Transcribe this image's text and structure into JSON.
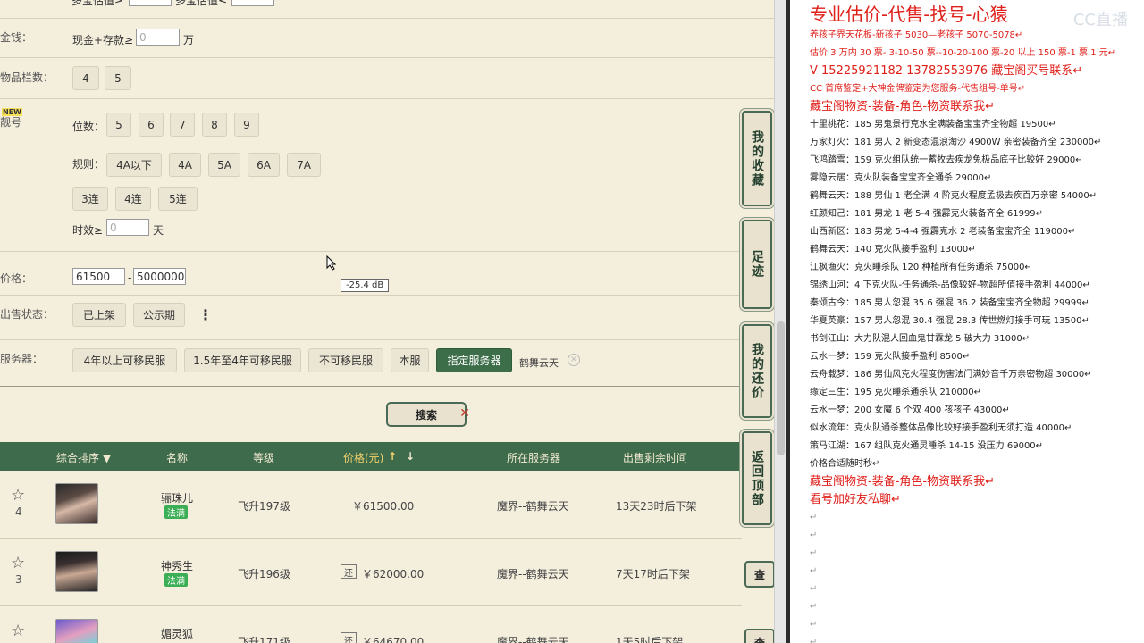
{
  "filters": {
    "top_partial": {
      "label_a": "多宝估值≥",
      "label_b": "多宝估值≤"
    },
    "money": {
      "label": "金钱：",
      "sub": "现金+存款≥",
      "placeholder": "0",
      "unit": "万"
    },
    "inventory": {
      "label": "物品栏数：",
      "options": [
        "4",
        "5"
      ]
    },
    "pretty_id": {
      "label": "靓号",
      "badge": "NEW",
      "digits_label": "位数：",
      "digits": [
        "5",
        "6",
        "7",
        "8",
        "9"
      ],
      "rule_label": "规则：",
      "rules": [
        "4A以下",
        "4A",
        "5A",
        "6A",
        "7A"
      ],
      "consec": [
        "3连",
        "4连",
        "5连"
      ],
      "valid_label": "时效≥",
      "valid_placeholder": "0",
      "valid_unit": "天"
    },
    "price": {
      "label": "价格：",
      "min": "61500",
      "dash": "-",
      "max": "5000000"
    },
    "status": {
      "label": "出售状态：",
      "options": [
        "已上架",
        "公示期"
      ],
      "more": "⋮"
    },
    "server": {
      "label": "服务器：",
      "options": [
        "4年以上可移民服",
        "1.5年至4年可移民服",
        "不可移民服",
        "本服",
        "指定服务器"
      ],
      "selected_server": "鹤舞云天",
      "clear": "×"
    }
  },
  "tooltip": "-25.4 dB",
  "side_tabs": [
    {
      "label": "我的收藏"
    },
    {
      "label": "足迹"
    },
    {
      "label": "我的还价"
    },
    {
      "label": "返回顶部"
    }
  ],
  "search_label": "搜索",
  "table": {
    "headers": {
      "rank": "综合排序 ▼",
      "name": "名称",
      "level": "等级",
      "price": "价格(元)",
      "server": "所在服务器",
      "time": "出售剩余时间"
    },
    "rows": [
      {
        "count": "4",
        "name": "骊珠儿",
        "tag": "法满",
        "level": "飞升197级",
        "price": "￥61500.00",
        "server": "魔界--鹤舞云天",
        "time": "13天23时后下架",
        "bargain": false
      },
      {
        "count": "3",
        "name": "神秀生",
        "tag": "法满",
        "level": "飞升196级",
        "price": "￥62000.00",
        "server": "魔界--鹤舞云天",
        "time": "7天17时后下架",
        "bargain": true,
        "bargain_label": "还",
        "view": "查"
      },
      {
        "count": "",
        "name": "媚灵狐",
        "tag": "",
        "level": "飞升171级",
        "price": "￥64670.00",
        "server": "魔界--鹤舞云天",
        "time": "1天5时后下架",
        "bargain": true,
        "bargain_label": "还",
        "view": "查"
      }
    ]
  },
  "notes": {
    "title": "专业估价-代售-找号-心猿",
    "watermark": "CC直播",
    "lines": [
      {
        "t": "养孩子界天花板-新孩子 5030—老孩子 5070-5078↵",
        "c": "red",
        "s": "small"
      },
      {
        "t": "估价 3 万内 30 票- 3-10-50 票--10-20-100 票-20 以上 150 票-1 票 1 元↵",
        "c": "red",
        "s": "small"
      },
      {
        "t": "V 15225921182     13782553976   藏宝阁买号联系↵",
        "c": "red",
        "s": "mid"
      },
      {
        "t": "CC 首席鉴定+大神金牌鉴定为您服务-代售组号-单号↵",
        "c": "red",
        "s": "small"
      },
      {
        "t": "藏宝阁物资-装备-角色-物资联系我↵",
        "c": "red",
        "s": "mid"
      },
      {
        "t": "十里桃花：185 男鬼景行克水全满装备宝宝齐全物超 19500↵",
        "c": "",
        "s": "small"
      },
      {
        "t": "万家灯火：181 男人 2 新变态混浪淘沙 4900W 亲密装备齐全 230000↵",
        "c": "",
        "s": "small"
      },
      {
        "t": "飞鸿踏雪：159 克火组队统一蓄牧去疾龙免极品底子比较好 29000↵",
        "c": "",
        "s": "small"
      },
      {
        "t": "雾隐云居：克火队装备宝宝齐全通杀 29000↵",
        "c": "",
        "s": "small"
      },
      {
        "t": "鹤舞云天：188 男仙 1 老全满 4 阶克火程度孟极去疾百万亲密 54000↵",
        "c": "",
        "s": "small"
      },
      {
        "t": "红颜知己：181 男龙 1 老 5-4 强霹克火装备齐全 61999↵",
        "c": "",
        "s": "small"
      },
      {
        "t": "山西新区：183 男龙 5-4-4 强霹克水 2 老装备宝宝齐全 119000↵",
        "c": "",
        "s": "small"
      },
      {
        "t": "鹤舞云天：140 克火队接手盈利 13000↵",
        "c": "",
        "s": "small"
      },
      {
        "t": "江枫渔火：克火睡杀队 120 种植所有任务通杀 75000↵",
        "c": "",
        "s": "small"
      },
      {
        "t": "锦绣山河：4 下克火队-任务通杀-品像较好-物超所值接手盈利 44000↵",
        "c": "",
        "s": "small"
      },
      {
        "t": "秦颂古今：185 男人忽混 35.6 强混 36.2 装备宝宝齐全物超 29999↵",
        "c": "",
        "s": "small"
      },
      {
        "t": "华夏英豪：157 男人忽混 30.4 强混 28.3 传世燃灯接手可玩 13500↵",
        "c": "",
        "s": "small"
      },
      {
        "t": "书剑江山：大力队混人回血鬼甘霖龙 5 破大力 31000↵",
        "c": "",
        "s": "small"
      },
      {
        "t": "云水一梦：159 克火队接手盈利 8500↵",
        "c": "",
        "s": "small"
      },
      {
        "t": "云舟载梦：186 男仙风克火程度伤害法门满妙音千万亲密物超 30000↵",
        "c": "",
        "s": "small"
      },
      {
        "t": "缘定三生：195 克火睡杀通杀队 210000↵",
        "c": "",
        "s": "small"
      },
      {
        "t": "云水一梦：200 女魔 6 个双 400 孩孩子 43000↵",
        "c": "",
        "s": "small"
      },
      {
        "t": "似水流年：克火队通杀整体品像比较好接手盈利无须打造 40000↵",
        "c": "",
        "s": "small"
      },
      {
        "t": "策马江湖：167 组队克火通灵睡杀 14-15 没压力 69000↵",
        "c": "",
        "s": "small"
      },
      {
        "t": "价格合适随时秒↵",
        "c": "",
        "s": "small"
      },
      {
        "t": "藏宝阁物资-装备-角色-物资联系我↵",
        "c": "red",
        "s": "mid"
      },
      {
        "t": "看号加好友私聊↵",
        "c": "red",
        "s": "mid"
      },
      {
        "t": "↵",
        "c": "para",
        "s": "small"
      },
      {
        "t": "↵",
        "c": "para",
        "s": "small"
      },
      {
        "t": "↵",
        "c": "para",
        "s": "small"
      },
      {
        "t": "↵",
        "c": "para",
        "s": "small"
      },
      {
        "t": "↵",
        "c": "para",
        "s": "small"
      },
      {
        "t": "↵",
        "c": "para",
        "s": "small"
      },
      {
        "t": "↵",
        "c": "para",
        "s": "small"
      },
      {
        "t": "↵",
        "c": "para",
        "s": "small"
      }
    ]
  }
}
